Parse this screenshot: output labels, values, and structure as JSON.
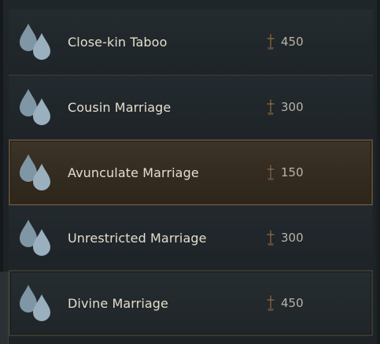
{
  "doctrines": [
    {
      "name": "Close-kin Taboo",
      "cost": "450",
      "state": "default"
    },
    {
      "name": "Cousin Marriage",
      "cost": "300",
      "state": "default"
    },
    {
      "name": "Avunculate Marriage",
      "cost": "150",
      "state": "selected"
    },
    {
      "name": "Unrestricted Marriage",
      "cost": "300",
      "state": "default"
    },
    {
      "name": "Divine Marriage",
      "cost": "450",
      "state": "highlight"
    }
  ],
  "icons": {
    "doctrine_icon": "water-drops-icon",
    "cost_icon": "piety-cross-icon"
  },
  "colors": {
    "drop_fill": "#8ea3b1",
    "label_text": "#e4ddcc",
    "cost_text": "#b9b3a6",
    "selected_bg": "#3d3428",
    "selected_border": "#5a4a36"
  }
}
